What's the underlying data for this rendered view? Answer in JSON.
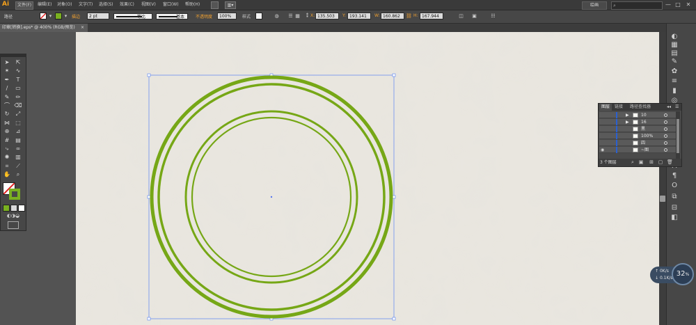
{
  "app": {
    "logo": "Ai"
  },
  "menu": {
    "items": [
      "文件(F)",
      "编辑(E)",
      "对象(O)",
      "文字(T)",
      "选择(S)",
      "效果(C)",
      "视图(V)",
      "窗口(W)",
      "帮助(H)"
    ],
    "workspace": "绘画",
    "window_controls": [
      "—",
      "□",
      "✕"
    ]
  },
  "control_bar": {
    "path_label": "路径",
    "stroke_label": "描边",
    "stroke_weight": "2 pt",
    "profile_label": "等比",
    "brush_label": "基本",
    "opacity_label": "不透明度",
    "opacity_value": "100%",
    "style_label": "样式",
    "x_value": "135.503",
    "y_value": "193.141",
    "w_value": "160.862",
    "h_value": "167.944",
    "colors": {
      "stroke_swatch": "#7ab020",
      "highlight": "#f0a030"
    }
  },
  "document_tab": {
    "title": "印章[转换].eps* @ 400% (RGB/预览)"
  },
  "layers_panel": {
    "tabs": [
      "图层",
      "链接",
      "路径查找器"
    ],
    "rows": [
      {
        "name": "10",
        "has_arrow": true
      },
      {
        "name": "16",
        "has_arrow": true
      },
      {
        "name": "黑",
        "has_arrow": false
      },
      {
        "name": "100%",
        "has_arrow": false
      },
      {
        "name": "四",
        "has_arrow": false
      },
      {
        "name": "~图",
        "has_arrow": false
      }
    ],
    "footer_count": "3 个图层"
  },
  "canvas": {
    "ring_color": "#76a716",
    "bg_color": "#e9e6df"
  },
  "speed_widget": {
    "percent": "32",
    "percent_unit": "%",
    "upload": "0K/s",
    "download": "0.1K/s"
  }
}
